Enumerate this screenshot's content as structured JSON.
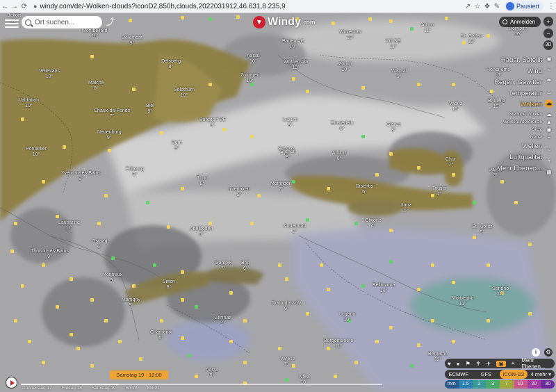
{
  "browser": {
    "back": "←",
    "forward": "→",
    "reload": "⟳",
    "lock": "🔒",
    "url": "windy.com/de/-Wolken-clouds?iconD2,850h,clouds,2022031912,46.631,8.235,9",
    "profile_label": "Pausiert"
  },
  "search": {
    "placeholder": "Ort suchen..."
  },
  "logo": {
    "text": "Windy",
    "suffix": ".com"
  },
  "account": {
    "login_label": "Anmelden"
  },
  "right_buttons": {
    "plus": "+",
    "minus": "−",
    "view3d": "3D"
  },
  "layers": [
    {
      "label": "Radar, Satellit",
      "small": false,
      "active": false
    },
    {
      "label": "Wind",
      "small": false,
      "active": false
    },
    {
      "label": "Regen, Gewitter",
      "small": false,
      "active": false
    },
    {
      "label": "Temperatur",
      "small": false,
      "active": false
    },
    {
      "label": "Wolken",
      "small": false,
      "active": true
    },
    {
      "label": "Niedrige Wolken",
      "small": true,
      "active": false
    },
    {
      "label": "Wolkenuntergrenze",
      "small": true,
      "active": false
    },
    {
      "label": "Sicht",
      "small": true,
      "active": false
    },
    {
      "label": "Nebel",
      "small": true,
      "active": false
    },
    {
      "label": "Wellen",
      "small": false,
      "active": false
    },
    {
      "label": "Luftqualität",
      "small": false,
      "active": false
    },
    {
      "label": "Mehr Ebenen...",
      "small": false,
      "active": false
    }
  ],
  "cities": [
    {
      "name": "Belfort",
      "temp": "11°"
    },
    {
      "name": "Montbéliard",
      "temp": "11°"
    },
    {
      "name": "Delémont",
      "temp": "9°"
    },
    {
      "name": "Delsberg",
      "temp": "9°"
    },
    {
      "name": "Aarau",
      "temp": "10°"
    },
    {
      "name": "Baden AG",
      "temp": "10°"
    },
    {
      "name": "Winterthur",
      "temp": "10°"
    },
    {
      "name": "Wil SG",
      "temp": "11°"
    },
    {
      "name": "Arbon",
      "temp": "11°"
    },
    {
      "name": "St. Gallen",
      "temp": "10°"
    },
    {
      "name": "Dornbirn",
      "temp": "10°"
    },
    {
      "name": "Vellevans",
      "temp": "10°"
    },
    {
      "name": "Maiche",
      "temp": "8°"
    },
    {
      "name": "Solothurn",
      "temp": "10°"
    },
    {
      "name": "Zofingen",
      "temp": "10°"
    },
    {
      "name": "Wohlen AG",
      "temp": "10°"
    },
    {
      "name": "Zürich",
      "temp": "10°"
    },
    {
      "name": "Wattwil",
      "temp": "9°"
    },
    {
      "name": "Hohenems",
      "temp": "10°"
    },
    {
      "name": "Valdahon",
      "temp": "10°"
    },
    {
      "name": "Chaux-de-Fonds",
      "temp": "7°"
    },
    {
      "name": "Biel",
      "temp": "9°"
    },
    {
      "name": "Einsiedeln",
      "temp": "6°"
    },
    {
      "name": "Vaduz",
      "temp": "10°"
    },
    {
      "name": "Bludenz",
      "temp": "10°"
    },
    {
      "name": "Neuenburg",
      "temp": "9°"
    },
    {
      "name": "Burgdorf BE",
      "temp": "8°"
    },
    {
      "name": "Luzern",
      "temp": "9°"
    },
    {
      "name": "Schwyz",
      "temp": "8°"
    },
    {
      "name": "Glarus",
      "temp": "8°"
    },
    {
      "name": "Pontarlier",
      "temp": "10°"
    },
    {
      "name": "Bern",
      "temp": "9°"
    },
    {
      "name": "Sarnen",
      "temp": "8°"
    },
    {
      "name": "Altdorf",
      "temp": "8°"
    },
    {
      "name": "Chur",
      "temp": "7°"
    },
    {
      "name": "Davos",
      "temp": "3°"
    },
    {
      "name": "Yverdon-les-Bains",
      "temp": "9°"
    },
    {
      "name": "Fribourg",
      "temp": "8°"
    },
    {
      "name": "Thun",
      "temp": "8°"
    },
    {
      "name": "Interlaken",
      "temp": "8°"
    },
    {
      "name": "Meiringen",
      "temp": "7°"
    },
    {
      "name": "Disentis",
      "temp": "5°"
    },
    {
      "name": "Thusis",
      "temp": "4°"
    },
    {
      "name": "Ilanz",
      "temp": "5°"
    },
    {
      "name": "Lausanne",
      "temp": "11°"
    },
    {
      "name": "Gstaad",
      "temp": "6°"
    },
    {
      "name": "Adelboden",
      "temp": "5°"
    },
    {
      "name": "Andermatt",
      "temp": "2°"
    },
    {
      "name": "Olivone",
      "temp": "4°"
    },
    {
      "name": "St. Moritz",
      "temp": "0°"
    },
    {
      "name": "Montreux",
      "temp": "9°"
    },
    {
      "name": "Gampel",
      "temp": "7°"
    },
    {
      "name": "Brig",
      "temp": "6°"
    },
    {
      "name": "Bellinzona",
      "temp": "10°"
    },
    {
      "name": "Sondrio",
      "temp": "11°"
    },
    {
      "name": "Thonon-les-Bains",
      "temp": "9°"
    },
    {
      "name": "Sitten",
      "temp": "8°"
    },
    {
      "name": "Domodossola",
      "temp": "9°"
    },
    {
      "name": "Lugano",
      "temp": "10°"
    },
    {
      "name": "Morbegno",
      "temp": "11°"
    },
    {
      "name": "Martigny",
      "temp": "8°"
    },
    {
      "name": "Zermatt",
      "temp": "1°"
    },
    {
      "name": "Varese",
      "temp": "11°"
    },
    {
      "name": "Bergamo",
      "temp": "12°"
    },
    {
      "name": "Chamonix",
      "temp": "5°"
    },
    {
      "name": "Aosta",
      "temp": "9°"
    },
    {
      "name": "Borgomanero",
      "temp": "11°"
    },
    {
      "name": "Ivrea",
      "temp": "10°"
    }
  ],
  "tools": {
    "more_label": "Mehr Ebenen..."
  },
  "models": [
    "ECMWF",
    "GFS",
    "ICON-D2",
    "4 mehr ▾"
  ],
  "active_model": "ICON-D2",
  "scale": {
    "unit": "mm",
    "values": [
      "1.5",
      "2",
      "3",
      "7",
      "10",
      "20",
      "30"
    ],
    "colors": [
      "#2b5a8a",
      "#2b7fb0",
      "#3a9a9a",
      "#4aa86b",
      "#a0a83a",
      "#c85a8a",
      "#a03aa0",
      "#6a2a9a"
    ]
  },
  "timeline": {
    "current": "Samstag 19 - 13:00",
    "days": [
      "Donnerstag 17",
      "Freitag 18",
      "Samstag 19",
      "So 20",
      "Mo 21"
    ]
  }
}
